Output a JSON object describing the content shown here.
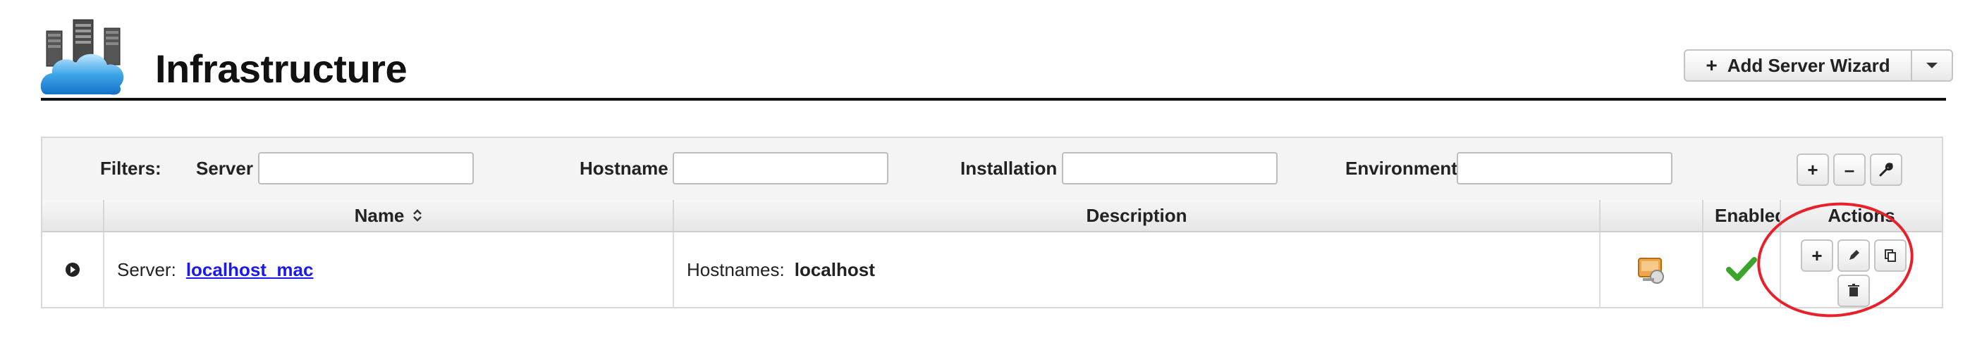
{
  "header": {
    "title": "Infrastructure",
    "wizard_button_label": "Add Server Wizard",
    "wizard_button_icon": "plus-icon",
    "logo_icon": "cloud-servers-icon"
  },
  "filters": {
    "label": "Filters:",
    "fields": [
      {
        "label": "Server",
        "value": ""
      },
      {
        "label": "Hostname",
        "value": ""
      },
      {
        "label": "Installation",
        "value": ""
      },
      {
        "label": "Environment",
        "value": ""
      }
    ],
    "buttons": [
      {
        "icon": "plus-icon",
        "glyph": "+"
      },
      {
        "icon": "minus-icon",
        "glyph": "–"
      },
      {
        "icon": "wrench-icon"
      }
    ]
  },
  "table": {
    "columns": {
      "name": "Name",
      "name_sort_icon": "sort-icon",
      "description": "Description",
      "type_icon": "",
      "enabled": "Enabled",
      "actions": "Actions"
    },
    "rows": [
      {
        "expand_icon": "expand-circle-icon",
        "name_prefix": "Server:",
        "name_link": "localhost_mac",
        "description_prefix": "Hostnames:",
        "description_value": "localhost",
        "type_icon": "server-machine-icon",
        "enabled_icon": "checkmark-icon",
        "actions": [
          {
            "icon": "plus-icon",
            "glyph": "+"
          },
          {
            "icon": "pencil-icon"
          },
          {
            "icon": "copy-icon"
          },
          {
            "icon": "trash-icon"
          }
        ]
      }
    ]
  },
  "colors": {
    "link": "#1a1aee",
    "annotation": "#e8202a",
    "check": "#3aa52a"
  }
}
